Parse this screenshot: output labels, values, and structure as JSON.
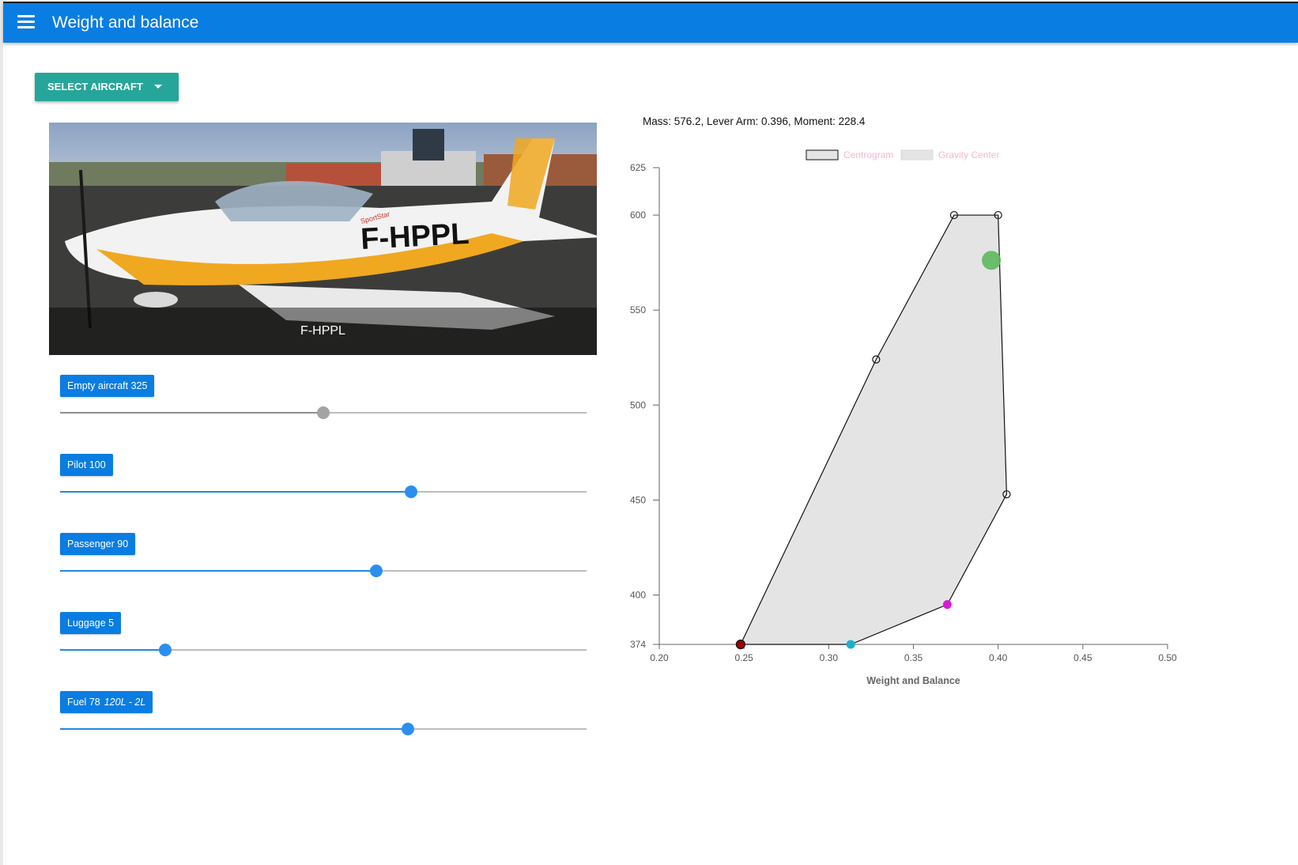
{
  "app": {
    "title": "Weight and balance",
    "menu_icon": "hamburger-menu-icon"
  },
  "select_button": {
    "label": "SELECT AIRCRAFT",
    "icon": "caret-down-icon"
  },
  "aircraft": {
    "caption": "F-HPPL",
    "registration": "F-HPPL",
    "brand": "SportStar"
  },
  "sliders": [
    {
      "key": "empty",
      "name_label": "Empty aircraft",
      "value_text": "325",
      "extra": "",
      "fraction": 0.5,
      "disabled": true
    },
    {
      "key": "pilot",
      "name_label": "Pilot",
      "value_text": "100",
      "extra": "",
      "fraction": 0.667,
      "disabled": false
    },
    {
      "key": "passenger",
      "name_label": "Passenger",
      "value_text": "90",
      "extra": "",
      "fraction": 0.6,
      "disabled": false
    },
    {
      "key": "luggage",
      "name_label": "Luggage",
      "value_text": "5",
      "extra": "",
      "fraction": 0.2,
      "disabled": false
    },
    {
      "key": "fuel",
      "name_label": "Fuel",
      "value_text": "78",
      "extra": "120L - 2L",
      "fraction": 0.66,
      "disabled": false
    }
  ],
  "summary": {
    "text": "Mass: 576.2, Lever Arm: 0.396, Moment: 228.4"
  },
  "chart_data": {
    "type": "scatter",
    "xlabel": "Weight and Balance",
    "ylabel": "",
    "xlim": [
      0.2,
      0.5
    ],
    "ylim": [
      374,
      625
    ],
    "x_ticks": [
      "0.20",
      "0.25",
      "0.30",
      "0.35",
      "0.40",
      "0.45",
      "0.50"
    ],
    "y_ticks": [
      "374",
      "400",
      "450",
      "500",
      "550",
      "600",
      "625"
    ],
    "legend": {
      "placement": "top",
      "entries": [
        "Centrogram",
        "Gravity Center"
      ]
    },
    "legend_text_color": "#f4b8c9",
    "series": [
      {
        "name": "Centrogram",
        "fill": "#e4e4e4",
        "stroke": "#111111",
        "points": [
          [
            0.248,
            374
          ],
          [
            0.328,
            524
          ],
          [
            0.374,
            600
          ],
          [
            0.4,
            600
          ],
          [
            0.405,
            453
          ],
          [
            0.37,
            395
          ],
          [
            0.313,
            374
          ]
        ]
      },
      {
        "name": "Gravity Center",
        "points": [
          [
            0.396,
            576.2
          ]
        ],
        "color": "#5cb85c"
      }
    ],
    "load_points": [
      {
        "x": 0.248,
        "y": 374,
        "color": "#9a0000"
      },
      {
        "x": 0.313,
        "y": 374,
        "color": "#1ab0cc"
      },
      {
        "x": 0.37,
        "y": 395,
        "color": "#d81bd8"
      }
    ]
  }
}
